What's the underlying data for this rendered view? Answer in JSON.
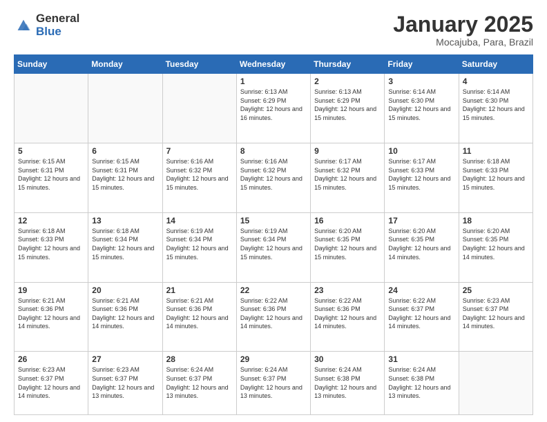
{
  "logo": {
    "general": "General",
    "blue": "Blue"
  },
  "header": {
    "month": "January 2025",
    "location": "Mocajuba, Para, Brazil"
  },
  "weekdays": [
    "Sunday",
    "Monday",
    "Tuesday",
    "Wednesday",
    "Thursday",
    "Friday",
    "Saturday"
  ],
  "weeks": [
    [
      {
        "day": "",
        "info": ""
      },
      {
        "day": "",
        "info": ""
      },
      {
        "day": "",
        "info": ""
      },
      {
        "day": "1",
        "info": "Sunrise: 6:13 AM\nSunset: 6:29 PM\nDaylight: 12 hours and 16 minutes."
      },
      {
        "day": "2",
        "info": "Sunrise: 6:13 AM\nSunset: 6:29 PM\nDaylight: 12 hours and 15 minutes."
      },
      {
        "day": "3",
        "info": "Sunrise: 6:14 AM\nSunset: 6:30 PM\nDaylight: 12 hours and 15 minutes."
      },
      {
        "day": "4",
        "info": "Sunrise: 6:14 AM\nSunset: 6:30 PM\nDaylight: 12 hours and 15 minutes."
      }
    ],
    [
      {
        "day": "5",
        "info": "Sunrise: 6:15 AM\nSunset: 6:31 PM\nDaylight: 12 hours and 15 minutes."
      },
      {
        "day": "6",
        "info": "Sunrise: 6:15 AM\nSunset: 6:31 PM\nDaylight: 12 hours and 15 minutes."
      },
      {
        "day": "7",
        "info": "Sunrise: 6:16 AM\nSunset: 6:32 PM\nDaylight: 12 hours and 15 minutes."
      },
      {
        "day": "8",
        "info": "Sunrise: 6:16 AM\nSunset: 6:32 PM\nDaylight: 12 hours and 15 minutes."
      },
      {
        "day": "9",
        "info": "Sunrise: 6:17 AM\nSunset: 6:32 PM\nDaylight: 12 hours and 15 minutes."
      },
      {
        "day": "10",
        "info": "Sunrise: 6:17 AM\nSunset: 6:33 PM\nDaylight: 12 hours and 15 minutes."
      },
      {
        "day": "11",
        "info": "Sunrise: 6:18 AM\nSunset: 6:33 PM\nDaylight: 12 hours and 15 minutes."
      }
    ],
    [
      {
        "day": "12",
        "info": "Sunrise: 6:18 AM\nSunset: 6:33 PM\nDaylight: 12 hours and 15 minutes."
      },
      {
        "day": "13",
        "info": "Sunrise: 6:18 AM\nSunset: 6:34 PM\nDaylight: 12 hours and 15 minutes."
      },
      {
        "day": "14",
        "info": "Sunrise: 6:19 AM\nSunset: 6:34 PM\nDaylight: 12 hours and 15 minutes."
      },
      {
        "day": "15",
        "info": "Sunrise: 6:19 AM\nSunset: 6:34 PM\nDaylight: 12 hours and 15 minutes."
      },
      {
        "day": "16",
        "info": "Sunrise: 6:20 AM\nSunset: 6:35 PM\nDaylight: 12 hours and 15 minutes."
      },
      {
        "day": "17",
        "info": "Sunrise: 6:20 AM\nSunset: 6:35 PM\nDaylight: 12 hours and 14 minutes."
      },
      {
        "day": "18",
        "info": "Sunrise: 6:20 AM\nSunset: 6:35 PM\nDaylight: 12 hours and 14 minutes."
      }
    ],
    [
      {
        "day": "19",
        "info": "Sunrise: 6:21 AM\nSunset: 6:36 PM\nDaylight: 12 hours and 14 minutes."
      },
      {
        "day": "20",
        "info": "Sunrise: 6:21 AM\nSunset: 6:36 PM\nDaylight: 12 hours and 14 minutes."
      },
      {
        "day": "21",
        "info": "Sunrise: 6:21 AM\nSunset: 6:36 PM\nDaylight: 12 hours and 14 minutes."
      },
      {
        "day": "22",
        "info": "Sunrise: 6:22 AM\nSunset: 6:36 PM\nDaylight: 12 hours and 14 minutes."
      },
      {
        "day": "23",
        "info": "Sunrise: 6:22 AM\nSunset: 6:36 PM\nDaylight: 12 hours and 14 minutes."
      },
      {
        "day": "24",
        "info": "Sunrise: 6:22 AM\nSunset: 6:37 PM\nDaylight: 12 hours and 14 minutes."
      },
      {
        "day": "25",
        "info": "Sunrise: 6:23 AM\nSunset: 6:37 PM\nDaylight: 12 hours and 14 minutes."
      }
    ],
    [
      {
        "day": "26",
        "info": "Sunrise: 6:23 AM\nSunset: 6:37 PM\nDaylight: 12 hours and 14 minutes."
      },
      {
        "day": "27",
        "info": "Sunrise: 6:23 AM\nSunset: 6:37 PM\nDaylight: 12 hours and 13 minutes."
      },
      {
        "day": "28",
        "info": "Sunrise: 6:24 AM\nSunset: 6:37 PM\nDaylight: 12 hours and 13 minutes."
      },
      {
        "day": "29",
        "info": "Sunrise: 6:24 AM\nSunset: 6:37 PM\nDaylight: 12 hours and 13 minutes."
      },
      {
        "day": "30",
        "info": "Sunrise: 6:24 AM\nSunset: 6:38 PM\nDaylight: 12 hours and 13 minutes."
      },
      {
        "day": "31",
        "info": "Sunrise: 6:24 AM\nSunset: 6:38 PM\nDaylight: 12 hours and 13 minutes."
      },
      {
        "day": "",
        "info": ""
      }
    ]
  ]
}
